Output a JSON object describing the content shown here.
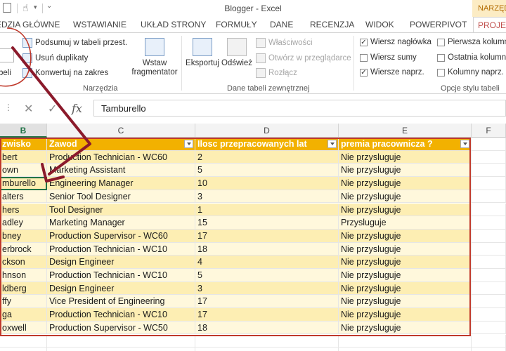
{
  "window": {
    "title": "Blogger - Excel",
    "context_tab": "NARZĘD"
  },
  "ribbon_tabs": [
    {
      "label": "EDZIA GŁÓWNE",
      "active": false
    },
    {
      "label": "WSTAWIANIE",
      "active": false
    },
    {
      "label": "UKŁAD STRONY",
      "active": false
    },
    {
      "label": "FORMUŁY",
      "active": false
    },
    {
      "label": "DANE",
      "active": false
    },
    {
      "label": "RECENZJA",
      "active": false
    },
    {
      "label": "WIDOK",
      "active": false
    },
    {
      "label": "POWERPIVOT",
      "active": false
    },
    {
      "label": "PROJEKT",
      "active": true
    }
  ],
  "ribbon": {
    "name_box_label": "beli",
    "tools": {
      "summarize": "Podsumuj w tabeli przest.",
      "remove_dupes": "Usuń duplikaty",
      "convert": "Konwertuj na zakres",
      "slicer": "Wstaw fragmentator",
      "group_label": "Narzędzia"
    },
    "external": {
      "export": "Eksportuj",
      "refresh": "Odśwież",
      "properties": "Właściwości",
      "open_browser": "Otwórz w przeglądarce",
      "unlink": "Rozłącz",
      "group_label": "Dane tabeli zewnętrznej"
    },
    "style_options": {
      "header_row": {
        "label": "Wiersz nagłówka",
        "checked": true
      },
      "total_row": {
        "label": "Wiersz sumy",
        "checked": false
      },
      "banded_rows": {
        "label": "Wiersze naprz.",
        "checked": true
      },
      "first_col": {
        "label": "Pierwsza kolumn",
        "checked": false
      },
      "last_col": {
        "label": "Ostatnia kolumn",
        "checked": false
      },
      "banded_cols": {
        "label": "Kolumny naprz.",
        "checked": false
      },
      "group_label": "Opcje stylu tabeli"
    }
  },
  "formula_bar": {
    "fx": "fx",
    "value": "Tamburello"
  },
  "columns": [
    "B",
    "C",
    "D",
    "E",
    "F"
  ],
  "table": {
    "headers": [
      "zwisko",
      "Zawod",
      "Ilosc przepracowanych lat",
      "premia pracownicza ?"
    ],
    "rows": [
      [
        "bert",
        "Production Technician - WC60",
        "2",
        "Nie przysluguje"
      ],
      [
        "own",
        "Marketing Assistant",
        "5",
        "Nie przysluguje"
      ],
      [
        "mburello",
        "Engineering Manager",
        "10",
        "Nie przysluguje"
      ],
      [
        "alters",
        "Senior Tool Designer",
        "3",
        "Nie przysluguje"
      ],
      [
        "hers",
        "Tool Designer",
        "1",
        "Nie przysluguje"
      ],
      [
        "adley",
        "Marketing Manager",
        "15",
        "Przysluguje"
      ],
      [
        "bney",
        "Production Supervisor - WC60",
        "17",
        "Nie przysluguje"
      ],
      [
        "erbrock",
        "Production Technician - WC10",
        "18",
        "Nie przysluguje"
      ],
      [
        "ckson",
        "Design Engineer",
        "4",
        "Nie przysluguje"
      ],
      [
        "hnson",
        "Production Technician - WC10",
        "5",
        "Nie przysluguje"
      ],
      [
        "ldberg",
        "Design Engineer",
        "3",
        "Nie przysluguje"
      ],
      [
        "ffy",
        "Vice President of Engineering",
        "17",
        "Nie przysluguje"
      ],
      [
        "ga",
        "Production Technician - WC10",
        "17",
        "Nie przysluguje"
      ],
      [
        "oxwell",
        "Production Supervisor - WC50",
        "18",
        "Nie przysluguje"
      ]
    ]
  },
  "colors": {
    "accent": "#217346",
    "table_header": "#f2b100",
    "band_dark": "#fdeeb3",
    "band_light": "#fff8dc",
    "annotation": "#c0392b",
    "arrow": "#8b1a2b"
  },
  "icons": [
    "save-icon",
    "touch-mode-icon",
    "undo-icon",
    "redo-icon",
    "cancel-icon",
    "confirm-icon",
    "fx-icon",
    "dropdown-arrow-icon"
  ]
}
